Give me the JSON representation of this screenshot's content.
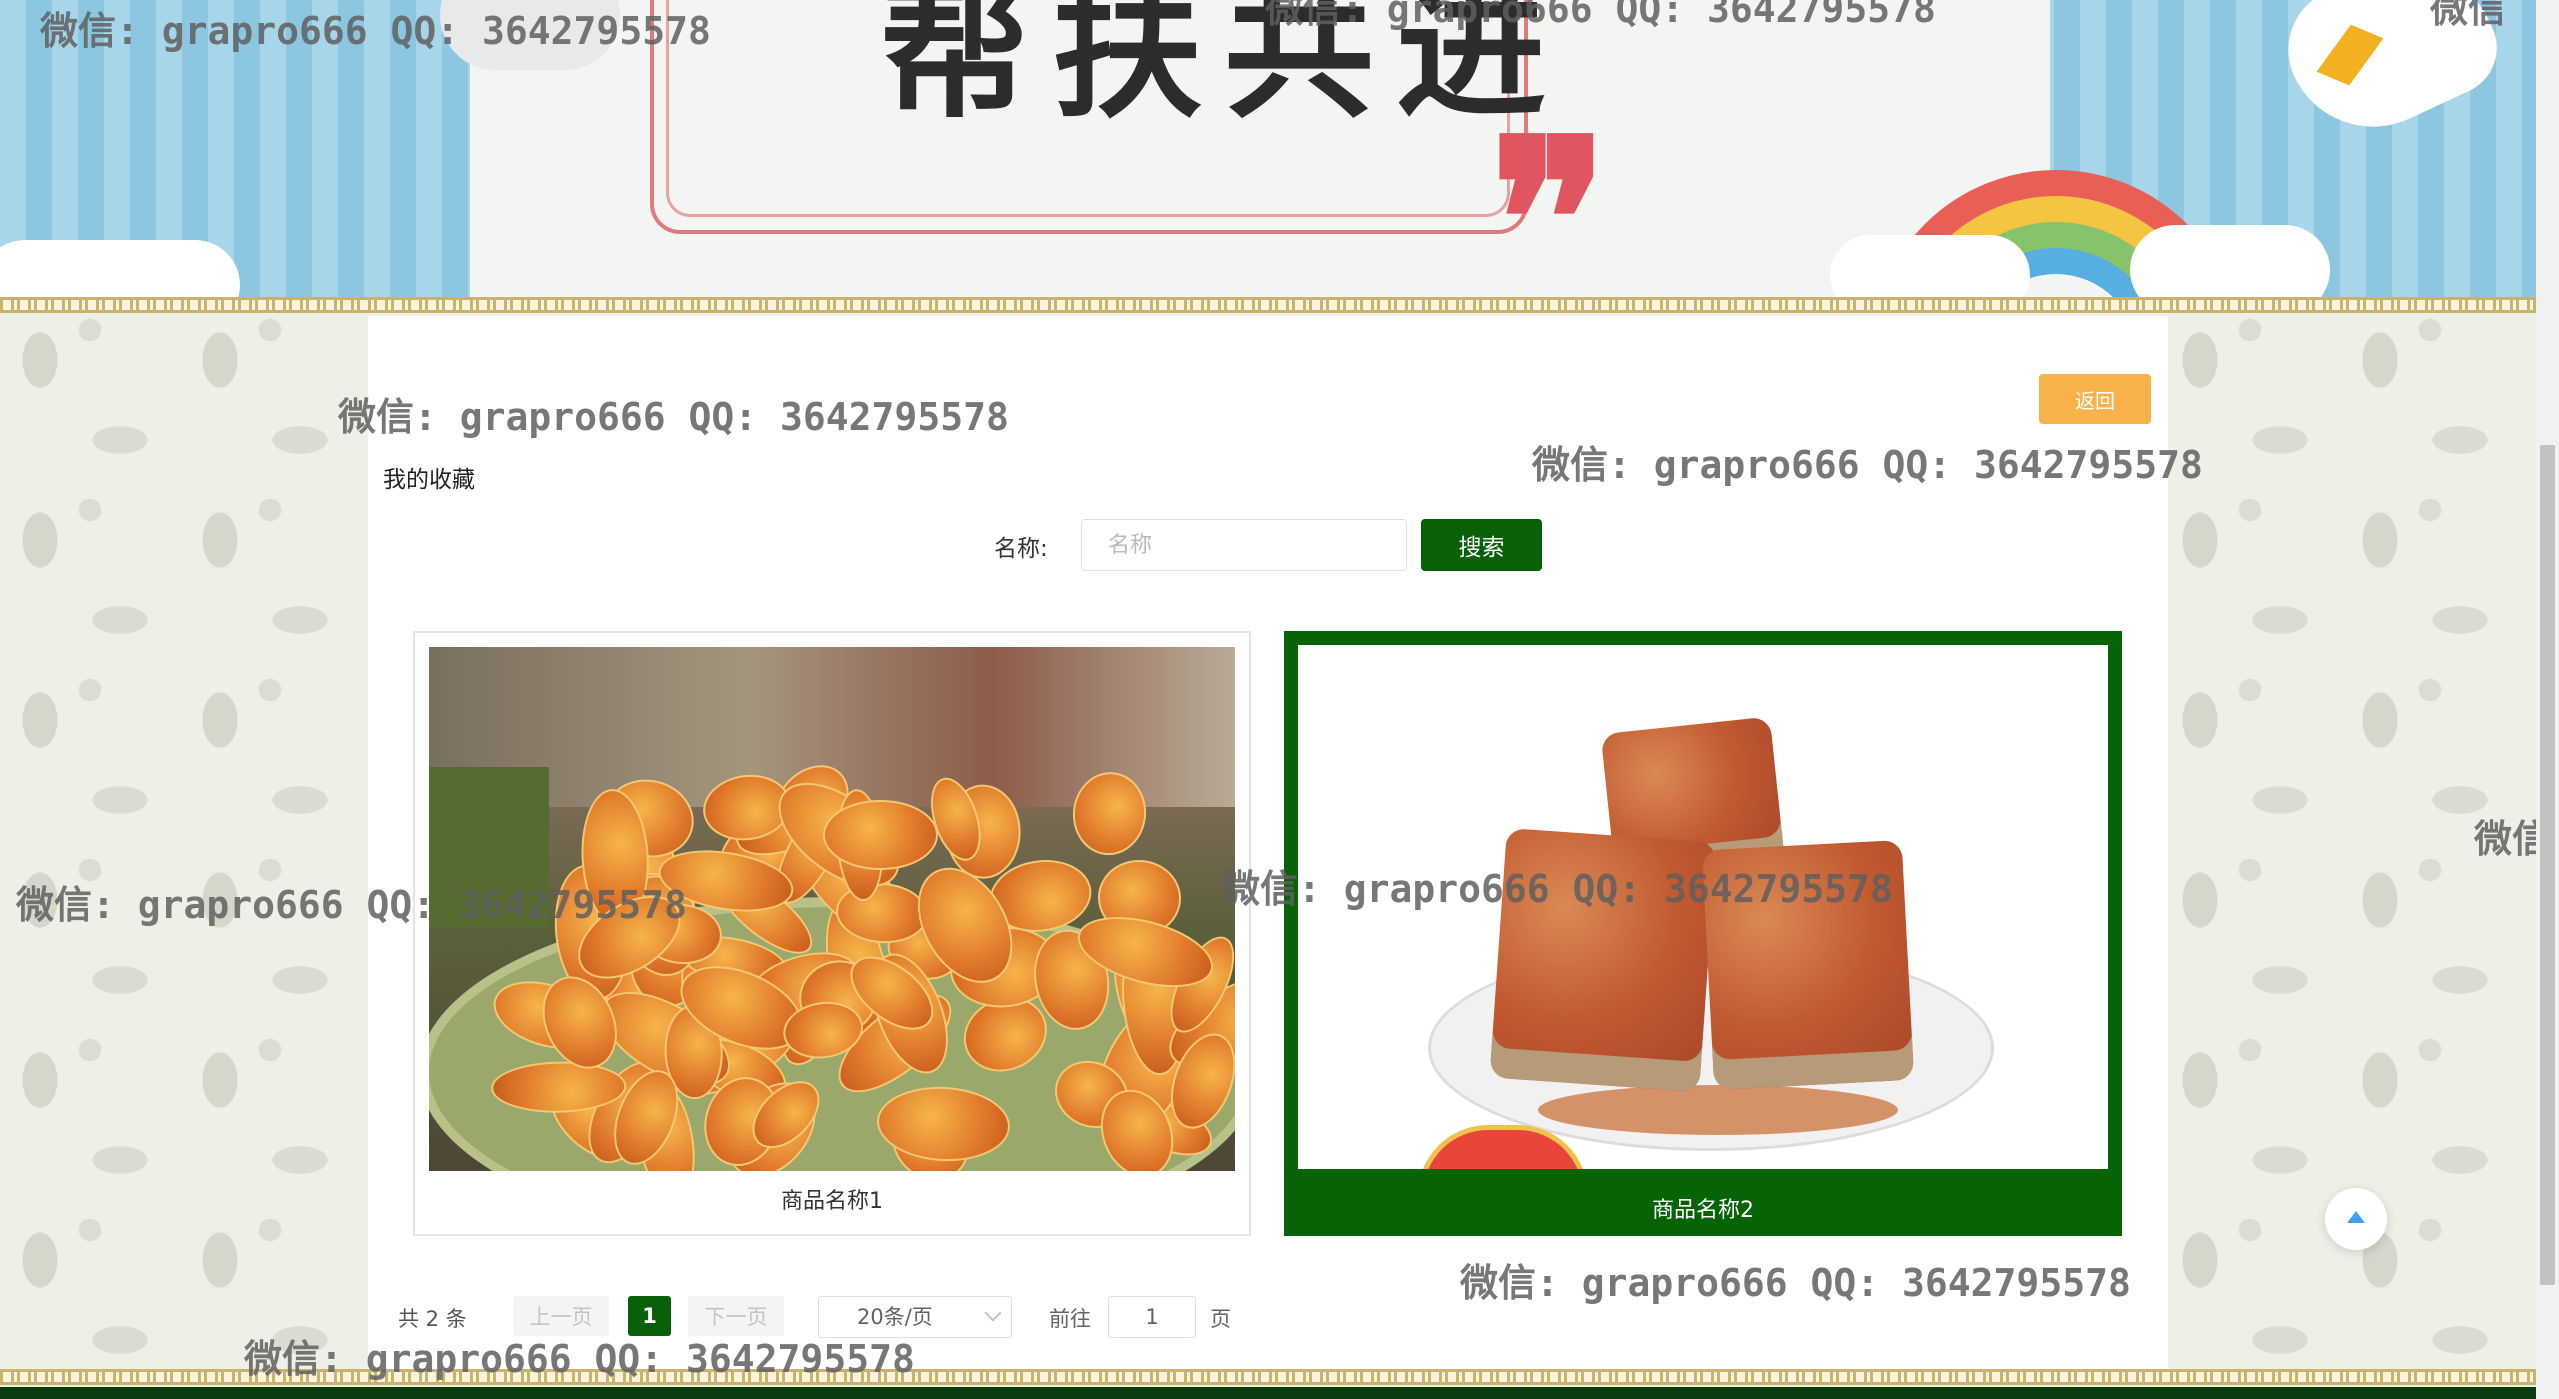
{
  "banner": {
    "title": "帮扶共进",
    "quote_marks": "❞"
  },
  "page": {
    "title": "我的收藏",
    "back_label": "返回"
  },
  "search": {
    "label": "名称:",
    "placeholder": "名称",
    "value": "",
    "button_label": "搜索"
  },
  "products": [
    {
      "name": "商品名称1",
      "image": "chips-photo",
      "selected": false
    },
    {
      "name": "商品名称2",
      "image": "tofu-photo",
      "selected": true
    }
  ],
  "pagination": {
    "total_label": "共 2 条",
    "prev_label": "上一页",
    "current_page": "1",
    "next_label": "下一页",
    "page_size_label": "20条/页",
    "goto_label": "前往",
    "goto_value": "1",
    "page_unit": "页"
  },
  "watermark": {
    "text": "微信: grapro666 QQ: 3642795578",
    "partial": "微信"
  },
  "colors": {
    "primary": "#086009",
    "accent": "#f7b34a",
    "link": "#409eff"
  },
  "icons": {
    "back_to_top": "arrow-up-icon",
    "dropdown": "chevron-down-icon"
  }
}
